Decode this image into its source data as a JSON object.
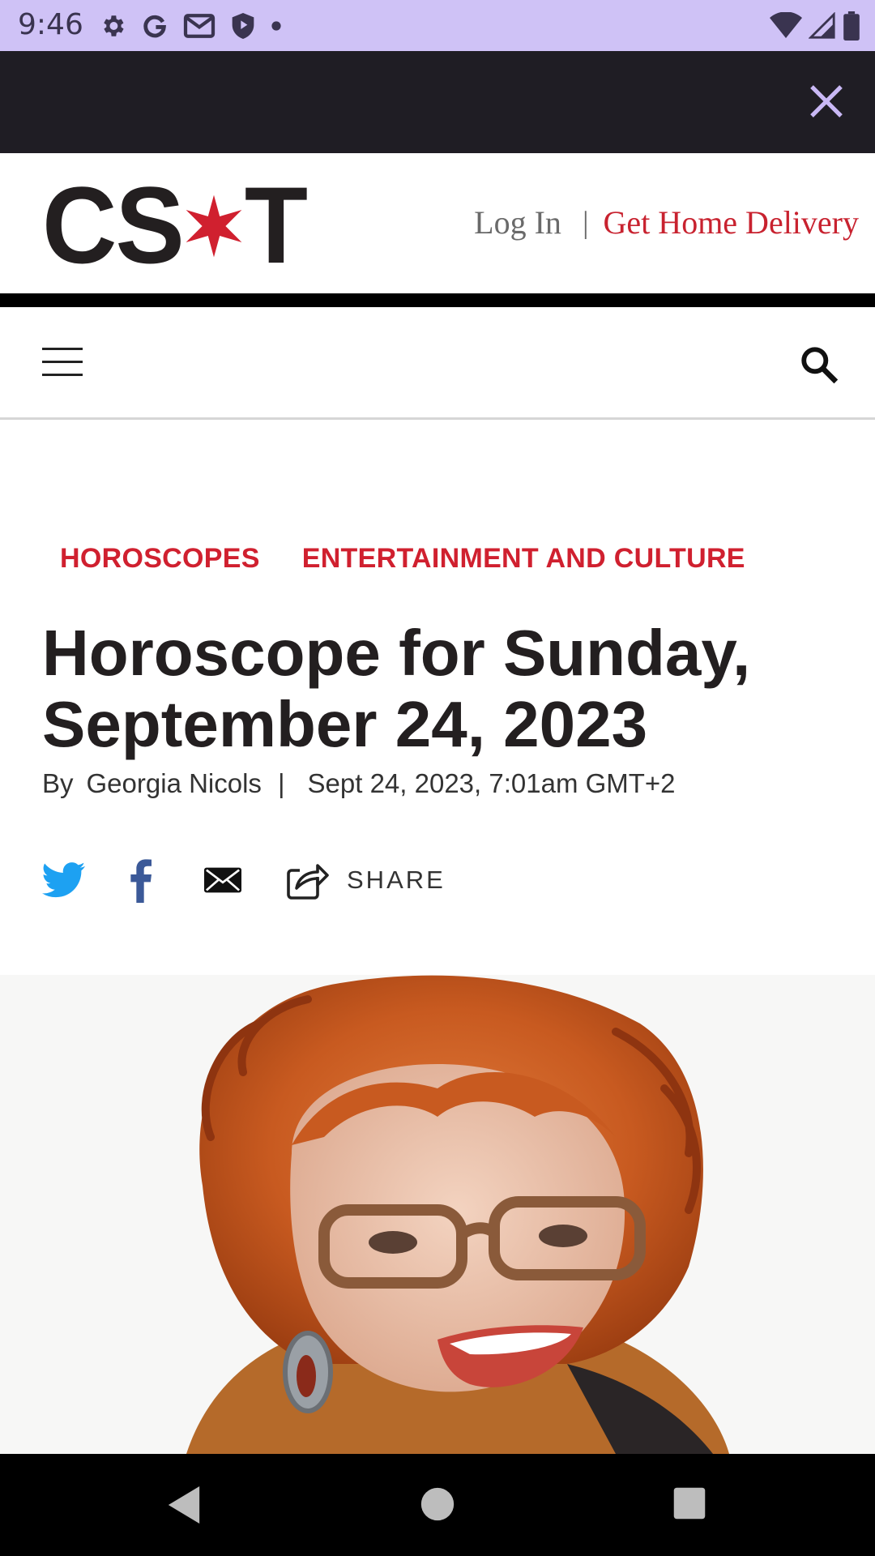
{
  "status_bar": {
    "time": "9:46",
    "left_icons": [
      "settings-icon",
      "google-icon",
      "gmail-icon",
      "shield-icon",
      "dot-icon"
    ],
    "right_icons": [
      "wifi-icon",
      "signal-icon",
      "battery-icon"
    ]
  },
  "ad_bar": {
    "close_icon": "close-icon",
    "close_color": "#c9b8f5"
  },
  "header": {
    "logo_left": "CS",
    "logo_right": "T",
    "logo_star_color": "#d0202f",
    "login_label": "Log In",
    "separator": "|",
    "delivery_label": "Get Home Delivery"
  },
  "nav": {
    "menu_icon": "hamburger-menu-icon",
    "search_icon": "search-icon"
  },
  "article": {
    "categories": [
      "HOROSCOPES",
      "ENTERTAINMENT AND CULTURE"
    ],
    "headline": "Horoscope for Sunday, September 24, 2023",
    "byline_prefix": "By",
    "author": "Georgia Nicols",
    "byline_sep": "|",
    "date": "Sept 24, 2023, 7:01am GMT+2",
    "share": {
      "icons": [
        "twitter-icon",
        "facebook-icon",
        "email-icon",
        "share-icon"
      ],
      "share_label": "SHARE"
    }
  },
  "colors": {
    "accent_red": "#d0202f",
    "twitter_blue": "#1da1f2",
    "facebook_blue": "#3b5998"
  },
  "system_nav": {
    "icons": [
      "back-icon",
      "home-icon",
      "recents-icon"
    ]
  }
}
